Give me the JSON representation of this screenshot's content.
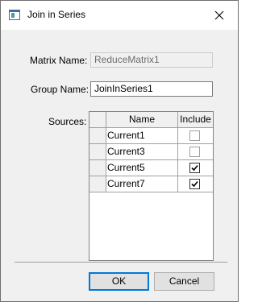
{
  "window": {
    "title": "Join in Series",
    "icon": "window-app-icon",
    "close_icon": "close-icon"
  },
  "form": {
    "matrix_name_label": "Matrix Name:",
    "matrix_name_value": "ReduceMatrix1",
    "group_name_label": "Group Name:",
    "group_name_value": "JoinInSeries1",
    "sources_label": "Sources:"
  },
  "sources_grid": {
    "columns": [
      "Name",
      "Include"
    ],
    "rows": [
      {
        "name": "Current1",
        "include": false
      },
      {
        "name": "Current3",
        "include": false
      },
      {
        "name": "Current5",
        "include": true
      },
      {
        "name": "Current7",
        "include": true
      }
    ]
  },
  "buttons": {
    "ok": "OK",
    "cancel": "Cancel"
  }
}
